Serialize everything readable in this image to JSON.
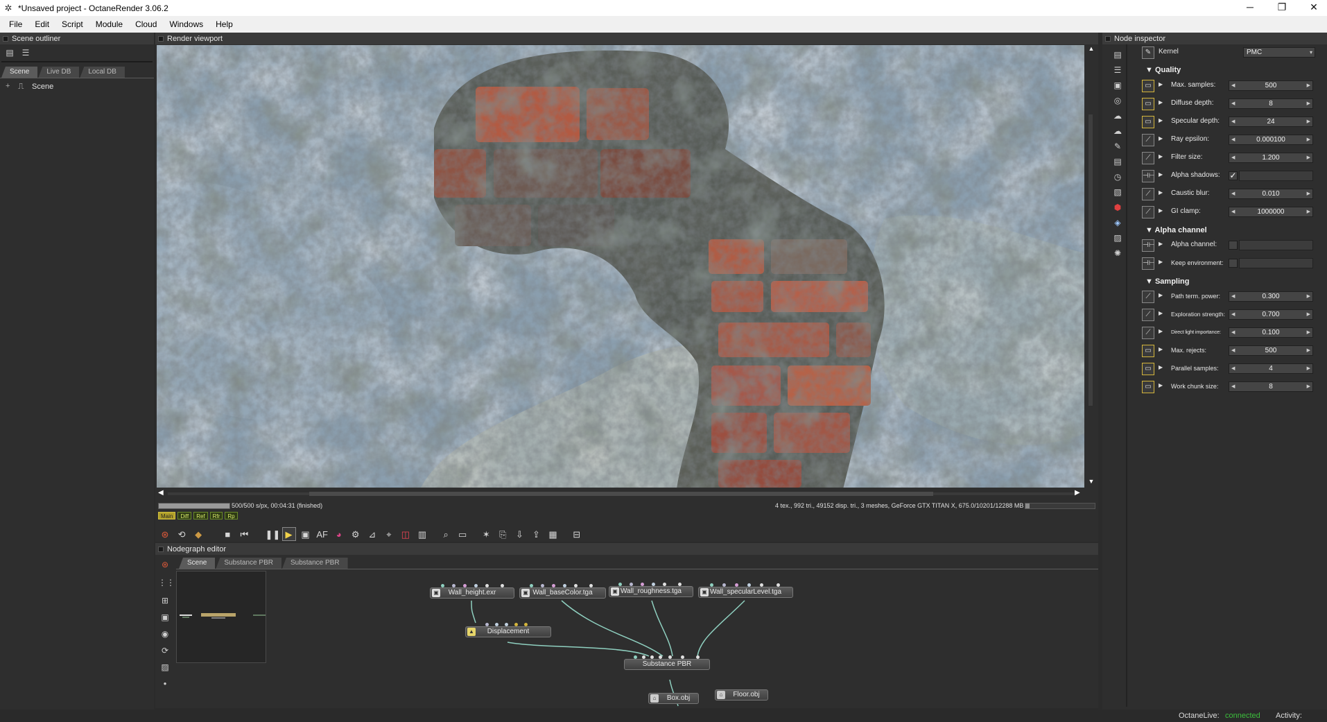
{
  "window": {
    "title": "*Unsaved project - OctaneRender 3.06.2",
    "controls": {
      "minimize": "─",
      "maximize": "❐",
      "close": "✕"
    }
  },
  "menu": [
    "File",
    "Edit",
    "Script",
    "Module",
    "Cloud",
    "Windows",
    "Help"
  ],
  "scene_outliner": {
    "title": "Scene outliner",
    "tabs": [
      "Scene",
      "Live DB",
      "Local DB"
    ],
    "tree": {
      "expander": "+",
      "root": "Scene"
    }
  },
  "render_viewport": {
    "title": "Render viewport",
    "progress_fraction": 1.0,
    "status_left": "500/500 s/px, 00:04:31 (finished)",
    "status_right": "4 tex., 992 tri., 49152 disp. tri., 3 meshes, GeForce GTX TITAN X, 675.0/10201/12288 MB",
    "passes": [
      "Main",
      "Diff",
      "Ref",
      "Rfr",
      "Rp"
    ]
  },
  "nodegraph_editor": {
    "title": "Nodegraph editor",
    "tabs": [
      "Scene",
      "Substance PBR",
      "Substance PBR"
    ],
    "nodes": {
      "height": "Wall_height.exr",
      "basecolor": "Wall_baseColor.tga",
      "roughness": "Wall_roughness.tga",
      "specular": "Wall_specularLevel.tga",
      "displacement": "Displacement",
      "substance": "Substance PBR",
      "box": "Box.obj",
      "floor": "Floor.obj"
    }
  },
  "node_inspector": {
    "title": "Node inspector",
    "kernel_label": "Kernel",
    "kernel_value": "PMC",
    "sections": {
      "quality": "Quality",
      "alpha": "Alpha channel",
      "sampling": "Sampling"
    },
    "params": {
      "max_samples": {
        "label": "Max. samples:",
        "value": "500"
      },
      "diffuse_depth": {
        "label": "Diffuse depth:",
        "value": "8"
      },
      "specular_depth": {
        "label": "Specular depth:",
        "value": "24"
      },
      "ray_epsilon": {
        "label": "Ray epsilon:",
        "value": "0.000100"
      },
      "filter_size": {
        "label": "Filter size:",
        "value": "1.200"
      },
      "alpha_shadows": {
        "label": "Alpha shadows:",
        "checked": true
      },
      "caustic_blur": {
        "label": "Caustic blur:",
        "value": "0.010"
      },
      "gi_clamp": {
        "label": "GI clamp:",
        "value": "1000000"
      },
      "alpha_channel": {
        "label": "Alpha channel:",
        "checked": false
      },
      "keep_environment": {
        "label": "Keep environment:",
        "checked": false
      },
      "path_term_power": {
        "label": "Path term. power:",
        "value": "0.300"
      },
      "exploration_strength": {
        "label": "Exploration strength:",
        "value": "0.700"
      },
      "direct_light_importance": {
        "label": "Direct light importance:",
        "value": "0.100"
      },
      "max_rejects": {
        "label": "Max. rejects:",
        "value": "500"
      },
      "parallel_samples": {
        "label": "Parallel samples:",
        "value": "4"
      },
      "work_chunk_size": {
        "label": "Work chunk size:",
        "value": "8"
      }
    }
  },
  "statusbar": {
    "octanelive_label": "OctaneLive:",
    "octanelive_status": "connected",
    "activity_label": "Activity:"
  },
  "colors": {
    "connected": "#3cbf3c",
    "node_wire": "#8fd0c0",
    "pin_highlight": "#d4b53c"
  }
}
